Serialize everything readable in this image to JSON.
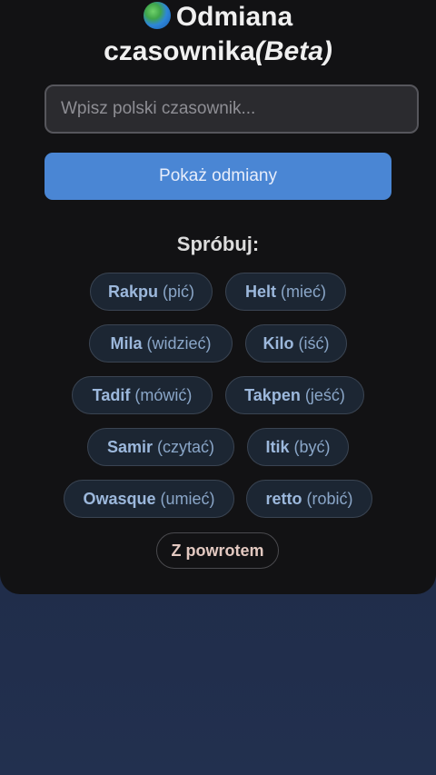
{
  "header": {
    "title_line1": "Odmiana",
    "title_line2": "czasownika",
    "title_beta": "(Beta)",
    "icon": "globe-icon"
  },
  "search": {
    "placeholder": "Wpisz polski czasownik...",
    "value": ""
  },
  "show_button": {
    "label": "Pokaż odmiany"
  },
  "examples": {
    "label": "Spróbuj:",
    "items": [
      {
        "word": "Rakpu",
        "translation": "(pić)"
      },
      {
        "word": "Helt",
        "translation": "(mieć)"
      },
      {
        "word": "Mila",
        "translation": "(widzieć)"
      },
      {
        "word": "Kilo",
        "translation": "(iść)"
      },
      {
        "word": "Tadif",
        "translation": "(mówić)"
      },
      {
        "word": "Takpen",
        "translation": "(jeść)"
      },
      {
        "word": "Samir",
        "translation": "(czytać)"
      },
      {
        "word": "Itik",
        "translation": "(być)"
      },
      {
        "word": "Owasque",
        "translation": "(umieć)"
      },
      {
        "word": "retto",
        "translation": "(robić)"
      }
    ]
  },
  "back_button": {
    "label": "Z powrotem"
  },
  "colors": {
    "accent": "#4a86d4",
    "card_bg": "#121214",
    "page_bg": "#1f2a45"
  }
}
